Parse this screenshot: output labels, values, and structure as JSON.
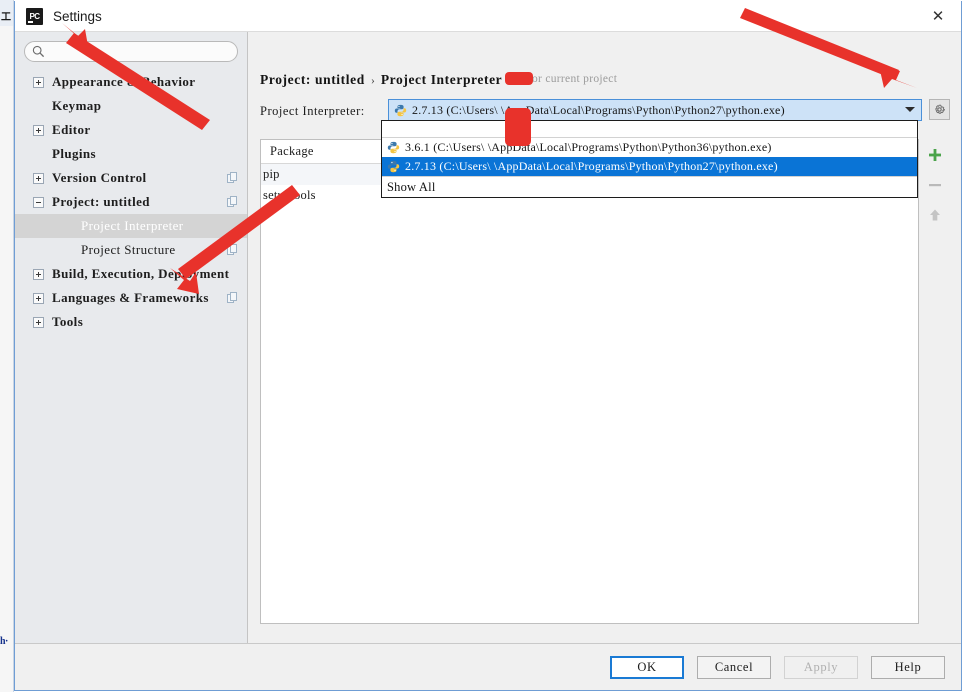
{
  "window": {
    "title": "Settings",
    "logo_text": "PC",
    "close_label": "✕"
  },
  "sidebar": {
    "search_placeholder": "",
    "search_value": "",
    "items": [
      {
        "label": "Appearance & Behavior",
        "toggle": "plus",
        "depth": 0,
        "selected": false,
        "copy": false
      },
      {
        "label": "Keymap",
        "toggle": "none",
        "depth": 0,
        "selected": false,
        "copy": false
      },
      {
        "label": "Editor",
        "toggle": "plus",
        "depth": 0,
        "selected": false,
        "copy": false
      },
      {
        "label": "Plugins",
        "toggle": "none",
        "depth": 0,
        "selected": false,
        "copy": false
      },
      {
        "label": "Version Control",
        "toggle": "plus",
        "depth": 0,
        "selected": false,
        "copy": true
      },
      {
        "label": "Project: untitled",
        "toggle": "minus",
        "depth": 0,
        "selected": false,
        "copy": true
      },
      {
        "label": "Project Interpreter",
        "toggle": "none",
        "depth": 2,
        "selected": true,
        "copy": false
      },
      {
        "label": "Project Structure",
        "toggle": "none",
        "depth": 2,
        "selected": false,
        "copy": true
      },
      {
        "label": "Build, Execution, Deployment",
        "toggle": "plus",
        "depth": 0,
        "selected": false,
        "copy": false
      },
      {
        "label": "Languages & Frameworks",
        "toggle": "plus",
        "depth": 0,
        "selected": false,
        "copy": true
      },
      {
        "label": "Tools",
        "toggle": "plus",
        "depth": 0,
        "selected": false,
        "copy": false
      }
    ]
  },
  "content": {
    "breadcrumb": {
      "parent": "Project: untitled",
      "separator": "›",
      "current": "Project Interpreter",
      "note": "For current project"
    },
    "interpreter": {
      "field_label": "Project Interpreter:",
      "selected_value": "2.7.13  (C:\\Users\\          \\AppData\\Local\\Programs\\Python\\Python27\\python.exe)"
    },
    "dropdown": {
      "options": [
        {
          "label": "3.6.1  (C:\\Users\\          \\AppData\\Local\\Programs\\Python\\Python36\\python.exe)",
          "selected": false
        },
        {
          "label": "2.7.13  (C:\\Users\\          \\AppData\\Local\\Programs\\Python\\Python27\\python.exe)",
          "selected": true
        }
      ],
      "show_all_label": "Show All"
    },
    "packages": {
      "column_header": "Package",
      "rows": [
        {
          "name": "pip"
        },
        {
          "name": "setuptools"
        }
      ]
    },
    "toolbar": {
      "add_label": "+",
      "remove_label": "−",
      "upgrade_label": "↑"
    }
  },
  "footer": {
    "ok_label": "OK",
    "cancel_label": "Cancel",
    "apply_label": "Apply",
    "help_label": "Help"
  },
  "background": {
    "top_glyph": "工",
    "bottom_glyph": "h·"
  },
  "colors": {
    "accent": "#0a74d6",
    "combo_fill": "#cde2f7",
    "combo_border": "#4a90d9",
    "selection": "#d4d4d4",
    "annotation_red": "#e8322b",
    "sidebar_bg": "#e8eaed",
    "dialog_bg": "#f0f0f0"
  }
}
